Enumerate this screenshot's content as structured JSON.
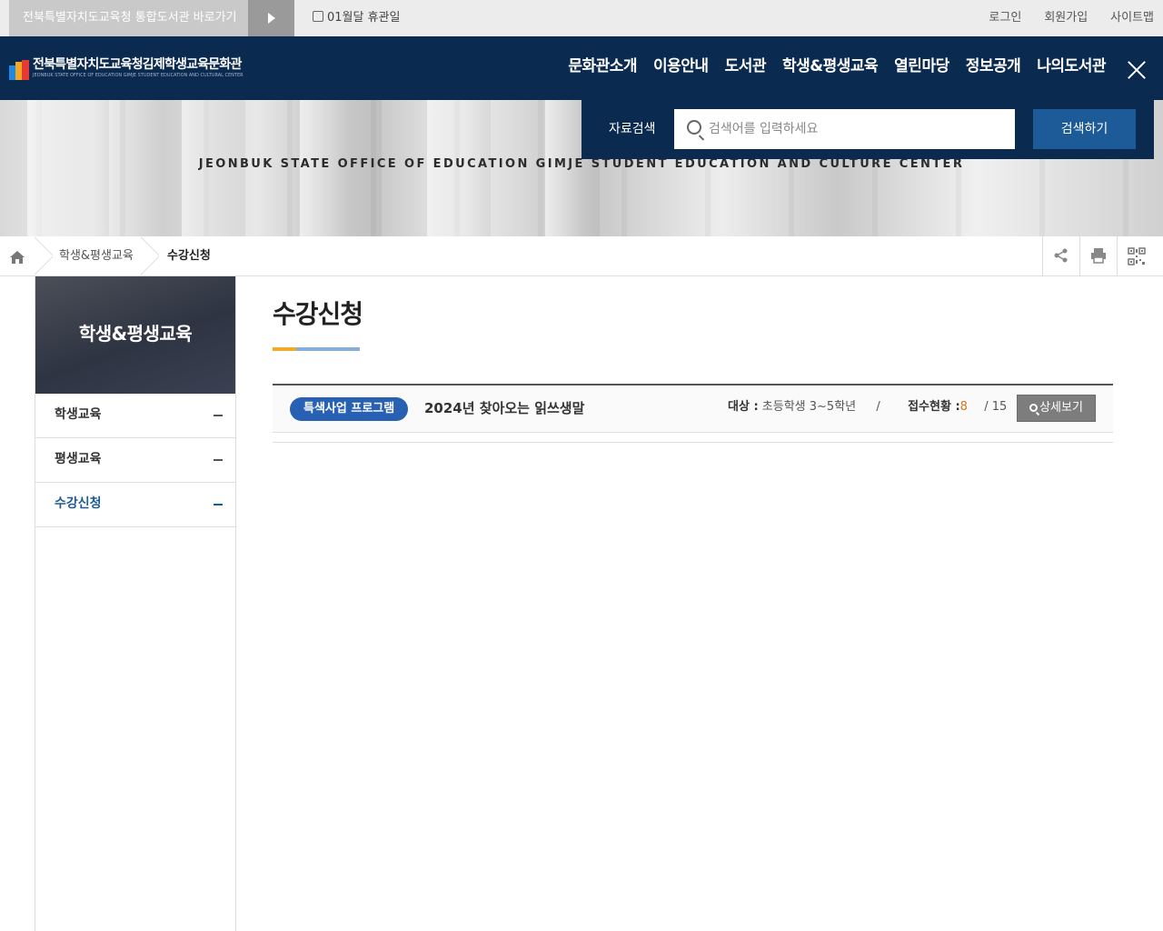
{
  "topbar": {
    "portal_link": "전북특별자치도교육청 통합도서관 바로가기",
    "holiday": "01월달 휴관일",
    "util": [
      "로그인",
      "회원가입",
      "사이트맵"
    ]
  },
  "header": {
    "logo_ko": "전북특별자치도교육청김제학생교육문화관",
    "logo_en": "JEONBUK STATE OFFICE OF EDUCATION GIMJE STUDENT EDUCATION AND CULTURAL CENTER",
    "gnb": [
      "문화관소개",
      "이용안내",
      "도서관",
      "학생&평생교육",
      "열린마당",
      "정보공개",
      "나의도서관"
    ]
  },
  "visual": {
    "slogan": "JEONBUK STATE OFFICE OF EDUCATION GIMJE STUDENT EDUCATION AND CULTURE CENTER"
  },
  "search": {
    "label": "자료검색",
    "placeholder": "검색어를 입력하세요",
    "button": "검색하기"
  },
  "breadcrumb": [
    "학생&평생교육",
    "수강신청"
  ],
  "lnb": {
    "title": "학생&평생교육",
    "items": [
      {
        "label": "학생교육",
        "active": false
      },
      {
        "label": "평생교육",
        "active": false
      },
      {
        "label": "수강신청",
        "active": true
      }
    ]
  },
  "content": {
    "title": "수강신청",
    "course": {
      "badge": "특색사업 프로그램",
      "name": "2024년 찾아오는 읽쓰생말",
      "target_label": "대상 :",
      "target": "초등학생 3~5학년",
      "divider": "/",
      "status_label": "접수현황 :",
      "status_count": "8",
      "status_total": "/ 15",
      "detail_button": "상세보기"
    }
  },
  "colors": {
    "header_bg": "#0b2a4f",
    "search_button": "#1d5a98",
    "badge": "#2861b4",
    "accent_orange": "#f0a92c",
    "accent_blue": "#87aed6",
    "count_color": "#d9771a"
  }
}
